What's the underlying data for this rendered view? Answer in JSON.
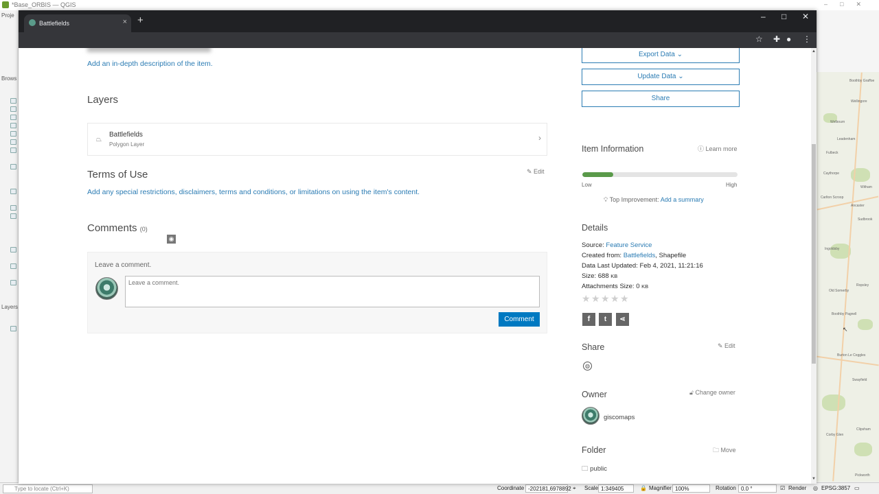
{
  "qgis": {
    "title": "*Base_ORBIS — QGIS",
    "left_labels": [
      "Proje",
      "Brows",
      "Layers"
    ],
    "locate_placeholder": "Type to locate (Ctrl+K)",
    "coordinate_label": "Coordinate",
    "coordinate_value": "-202181,6978892",
    "scale_label": "Scale",
    "scale_value": "1:349405",
    "magnifier_label": "Magnifier",
    "magnifier_value": "100%",
    "rotation_label": "Rotation",
    "rotation_value": "0.0 °",
    "render_label": "Render",
    "crs": "EPSG:3857",
    "map_places": [
      "Boothby Graffoe",
      "Wellingore",
      "Welbourn",
      "Leadenham",
      "Fulbeck",
      "Caythorpe",
      "Carlton Scroop",
      "Ancaster",
      "Sudbrook",
      "Old Somerby",
      "Ropsley",
      "Boothby Pagnell",
      "Burton Le Coggles",
      "Swayfield",
      "Corby Glen",
      "Clipsham",
      "Witham",
      "Ingoldsby",
      "Pickworth"
    ]
  },
  "browser": {
    "tab_title": "Battlefields",
    "tab_close": "×",
    "new_tab": "+",
    "win_min": "–",
    "win_max": "□",
    "win_close": "✕"
  },
  "main": {
    "description_link": "Add an in-depth description of the item.",
    "layers_heading": "Layers",
    "layer": {
      "name": "Battlefields",
      "type": "Polygon Layer"
    },
    "terms_heading": "Terms of Use",
    "edit_label": "Edit",
    "terms_link": "Add any special restrictions, disclaimers, terms and conditions, or limitations on using the item's content.",
    "comments_heading": "Comments",
    "comments_count": "(0)",
    "leave_comment_label": "Leave a comment.",
    "comment_placeholder": "Leave a comment.",
    "comment_button": "Comment"
  },
  "sidebar": {
    "export_data": "Export Data",
    "update_data": "Update Data",
    "share_button": "Share",
    "item_info_heading": "Item Information",
    "learn_more": "Learn more",
    "meter_fill": 0.2,
    "low": "Low",
    "high": "High",
    "top_improvement_label": "Top Improvement:",
    "top_improvement_link": "Add a summary",
    "details_heading": "Details",
    "source_label": "Source:",
    "source_value": "Feature Service",
    "created_label": "Created from:",
    "created_link": "Battlefields",
    "created_rest": ", Shapefile",
    "updated_label": "Data Last Updated:",
    "updated_value": "Feb 4, 2021, 11:21:16",
    "size_label": "Size:",
    "size_value": "688",
    "size_unit": "KB",
    "attach_label": "Attachments Size:",
    "attach_value": "0",
    "attach_unit": "KB",
    "rating": 0,
    "share_heading": "Share",
    "share_edit": "Edit",
    "owner_heading": "Owner",
    "change_owner": "Change owner",
    "owner_name": "giscomaps",
    "folder_heading": "Folder",
    "move_label": "Move",
    "folder_name": "public"
  },
  "colors": {
    "link": "#2a7bb3",
    "primary_button": "#0079c1",
    "meter": "#5a9a4a",
    "tab_bar": "#202124"
  }
}
